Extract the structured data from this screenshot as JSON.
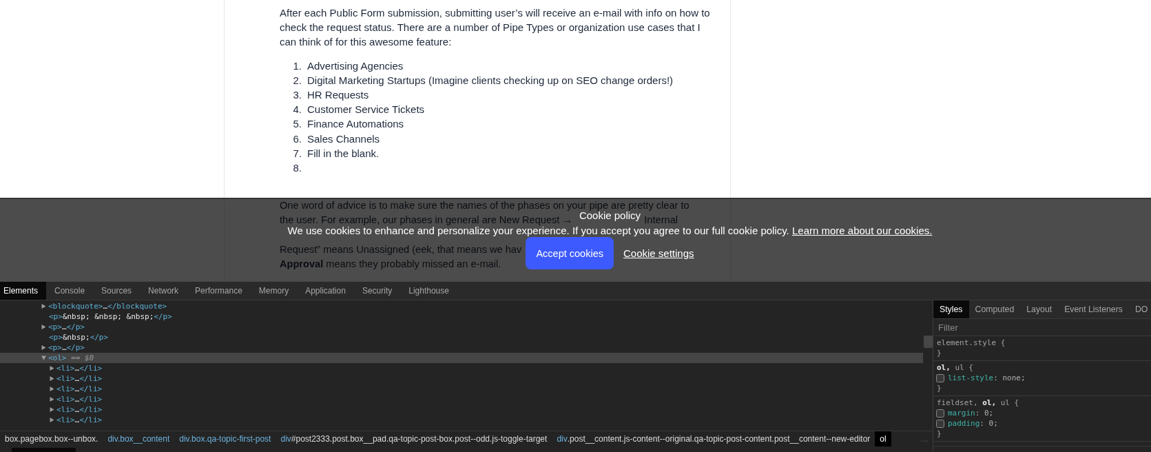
{
  "article": {
    "paragraph": "After each Public Form submission, submitting user’s will receive an e-mail with info on how to check the request status. There are a number of Pipe Types or organization use cases that I can think of for this awesome feature:",
    "use_cases": [
      {
        "number": "1.",
        "text": "Advertising Agencies"
      },
      {
        "number": "2.",
        "text": "Digital Marketing Startups (Imagine clients checking up on SEO change orders!)"
      },
      {
        "number": "3.",
        "text": "HR Requests"
      },
      {
        "number": "4.",
        "text": "Customer Service Tickets"
      },
      {
        "number": "5.",
        "text": "Finance Automations"
      },
      {
        "number": "6.",
        "text": "Sales Channels"
      },
      {
        "number": "7.",
        "text": "Fill in the blank."
      },
      {
        "number": "8."
      }
    ],
    "dimmed_lines_top": [
      [
        "One word of advice is to make sure the names of the phases on your pipe are pretty clear to"
      ],
      [
        "the user. For example, our phases in general are New Request →",
        "Internal"
      ]
    ],
    "dimmed_lines_bottom": [
      [
        "Request” means Unassigned (eek, that means we hav"
      ],
      [
        "**Approval** means they probably missed an e-mail."
      ]
    ]
  },
  "cookie_banner": {
    "title": "Cookie policy",
    "message": "We use cookies to enhance and personalize your experience. If you accept you agree to our full cookie policy.",
    "learn_more_link": "Learn more about our cookies.",
    "accept_button": "Accept cookies",
    "settings_link": "Cookie settings"
  },
  "devtools": {
    "tabs": [
      {
        "label": "Elements",
        "selected": true
      },
      {
        "label": "Console",
        "selected": false
      },
      {
        "label": "Sources",
        "selected": false
      },
      {
        "label": "Network",
        "selected": false
      },
      {
        "label": "Performance",
        "selected": false
      },
      {
        "label": "Memory",
        "selected": false
      },
      {
        "label": "Application",
        "selected": false
      },
      {
        "label": "Security",
        "selected": false
      },
      {
        "label": "Lighthouse",
        "selected": false
      }
    ],
    "tree": [
      {
        "kind": "parent",
        "expanded": false,
        "selected": false,
        "markup": [
          {
            "kind": "tag",
            "text": "<blockquote>"
          },
          {
            "kind": "text",
            "text": "…"
          },
          {
            "kind": "tag",
            "text": "</blockquote>"
          }
        ]
      },
      {
        "kind": "leaf",
        "selected": false,
        "markup": [
          {
            "kind": "tag",
            "text": "<p>"
          },
          {
            "kind": "text",
            "text": "&nbsp; &nbsp; &nbsp;"
          },
          {
            "kind": "tag",
            "text": "</p>"
          }
        ]
      },
      {
        "kind": "parent",
        "expanded": false,
        "selected": false,
        "markup": [
          {
            "kind": "tag",
            "text": "<p>"
          },
          {
            "kind": "text",
            "text": "…"
          },
          {
            "kind": "tag",
            "text": "</p>"
          }
        ]
      },
      {
        "kind": "leaf",
        "selected": false,
        "markup": [
          {
            "kind": "tag",
            "text": "<p>"
          },
          {
            "kind": "text",
            "text": "&nbsp;"
          },
          {
            "kind": "tag",
            "text": "</p>"
          }
        ]
      },
      {
        "kind": "parent",
        "expanded": false,
        "selected": false,
        "markup": [
          {
            "kind": "tag",
            "text": "<p>"
          },
          {
            "kind": "text",
            "text": "…"
          },
          {
            "kind": "tag",
            "text": "</p>"
          }
        ]
      },
      {
        "kind": "parent",
        "expanded": true,
        "selected": true,
        "markup": [
          {
            "kind": "tag",
            "text": "<ol>"
          },
          {
            "kind": "marker",
            "text": " == $0"
          }
        ],
        "children": [
          {
            "kind": "parent",
            "expanded": false,
            "selected": false,
            "markup": [
              {
                "kind": "tag",
                "text": "<li>"
              },
              {
                "kind": "text",
                "text": "…"
              },
              {
                "kind": "tag",
                "text": "</li>"
              }
            ]
          },
          {
            "kind": "parent",
            "expanded": false,
            "selected": false,
            "markup": [
              {
                "kind": "tag",
                "text": "<li>"
              },
              {
                "kind": "text",
                "text": "…"
              },
              {
                "kind": "tag",
                "text": "</li>"
              }
            ]
          },
          {
            "kind": "parent",
            "expanded": false,
            "selected": false,
            "markup": [
              {
                "kind": "tag",
                "text": "<li>"
              },
              {
                "kind": "text",
                "text": "…"
              },
              {
                "kind": "tag",
                "text": "</li>"
              }
            ]
          },
          {
            "kind": "parent",
            "expanded": false,
            "selected": false,
            "markup": [
              {
                "kind": "tag",
                "text": "<li>"
              },
              {
                "kind": "text",
                "text": "…"
              },
              {
                "kind": "tag",
                "text": "</li>"
              }
            ]
          },
          {
            "kind": "parent",
            "expanded": false,
            "selected": false,
            "markup": [
              {
                "kind": "tag",
                "text": "<li>"
              },
              {
                "kind": "text",
                "text": "…"
              },
              {
                "kind": "tag",
                "text": "</li>"
              }
            ]
          },
          {
            "kind": "parent",
            "expanded": false,
            "selected": false,
            "markup": [
              {
                "kind": "tag",
                "text": "<li>"
              },
              {
                "kind": "text",
                "text": "…"
              },
              {
                "kind": "tag",
                "text": "</li>"
              }
            ]
          }
        ]
      }
    ],
    "breadcrumbs": [
      {
        "selected": false,
        "parts": [
          {
            "kind": "text",
            "text": "box.pagebox.box--unbox."
          }
        ]
      },
      {
        "selected": false,
        "parts": [
          {
            "kind": "tag",
            "text": "div.box__content"
          }
        ]
      },
      {
        "selected": false,
        "parts": [
          {
            "kind": "tag",
            "text": "div.box.qa-topic-first-post"
          }
        ]
      },
      {
        "selected": false,
        "parts": [
          {
            "kind": "tag",
            "text": "div"
          },
          {
            "kind": "text",
            "text": "#post2333.post.box__pad.qa-topic-post-box.post--odd.js-toggle-target"
          }
        ]
      },
      {
        "selected": false,
        "parts": [
          {
            "kind": "tag",
            "text": "div"
          },
          {
            "kind": "text",
            "text": ".post__content.js-content--original.qa-topic-post-content.post__content--new-editor"
          }
        ]
      },
      {
        "selected": true,
        "parts": [
          {
            "kind": "text",
            "text": "ol"
          }
        ]
      }
    ],
    "breadcrumb_overflow": "…",
    "sidebar": {
      "tabs": [
        {
          "label": "Styles",
          "selected": true
        },
        {
          "label": "Computed",
          "selected": false
        },
        {
          "label": "Layout",
          "selected": false
        },
        {
          "label": "Event Listeners",
          "selected": false
        },
        {
          "label": "DO",
          "selected": false
        }
      ],
      "filter": {
        "placeholder": "Filter"
      },
      "rules": [
        {
          "selector": "element.style {",
          "close": "}"
        },
        {
          "selector": "**ol,** ul {",
          "declarations": [
            {
              "property": "list-style",
              "value": ": none;",
              "checked": false
            }
          ],
          "close": "}"
        },
        {
          "selector": "fieldset, **ol,** ul {",
          "declarations": [
            {
              "property": "margin",
              "value": ": 0;",
              "checked": false
            },
            {
              "property": "padding",
              "value": ": 0;",
              "checked": false
            }
          ],
          "close": "}"
        }
      ]
    }
  }
}
